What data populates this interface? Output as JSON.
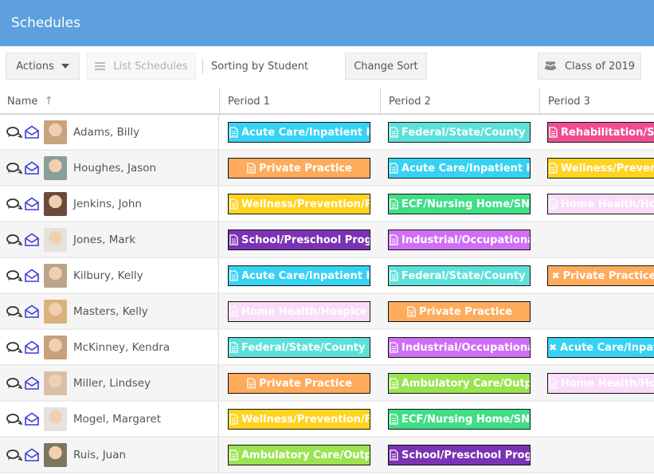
{
  "header": {
    "title": "Schedules"
  },
  "toolbar": {
    "actions_label": "Actions",
    "list_schedules_label": "List Schedules",
    "sorting_text": "Sorting by Student",
    "change_sort_label": "Change Sort",
    "class_label": "Class of 2019"
  },
  "columns": {
    "name": "Name",
    "p1": "Period 1",
    "p2": "Period 2",
    "p3": "Period 3"
  },
  "colors": {
    "acute": "#36d2f3",
    "federal": "#5ce1d9",
    "rehab": "#ef4d8f",
    "private": "#ffab5c",
    "wellness": "#ffd31f",
    "ecf": "#40df86",
    "home": "#fadcfa",
    "school": "#7b33b5",
    "industrial": "#d06ef5",
    "ambulatory": "#9be351",
    "header": "#5da0dd"
  },
  "rows": [
    {
      "name": "Adams, Billy",
      "p1": {
        "label": "Acute Care/Inpatient Hospital",
        "type": "acute",
        "icon": "file"
      },
      "p2": {
        "label": "Federal/State/County Health",
        "type": "federal",
        "icon": "file"
      },
      "p3": {
        "label": "Rehabilitation/Sub-Acute",
        "type": "rehab",
        "icon": "file"
      }
    },
    {
      "name": "Houghes, Jason",
      "p1": {
        "label": "Private Practice",
        "type": "private",
        "icon": "file"
      },
      "p2": {
        "label": "Acute Care/Inpatient Hospital",
        "type": "acute",
        "icon": "file"
      },
      "p3": {
        "label": "Wellness/Prevention/Fitness",
        "type": "wellness",
        "icon": "file"
      }
    },
    {
      "name": "Jenkins, John",
      "p1": {
        "label": "Wellness/Prevention/Fitness",
        "type": "wellness",
        "icon": "file"
      },
      "p2": {
        "label": "ECF/Nursing Home/SNF",
        "type": "ecf",
        "icon": "file"
      },
      "p3": {
        "label": "Home Health/Hospice",
        "type": "home",
        "icon": "file"
      }
    },
    {
      "name": "Jones, Mark",
      "p1": {
        "label": "School/Preschool Program",
        "type": "school",
        "icon": "file"
      },
      "p2": {
        "label": "Industrial/Occupational Health",
        "type": "industrial",
        "icon": "file"
      },
      "p3": null
    },
    {
      "name": "Kilbury, Kelly",
      "p1": {
        "label": "Acute Care/Inpatient Hospital",
        "type": "acute",
        "icon": "file"
      },
      "p2": {
        "label": "Federal/State/County Health",
        "type": "federal",
        "icon": "file"
      },
      "p3": {
        "label": "Private Practice",
        "type": "private",
        "icon": "x"
      }
    },
    {
      "name": "Masters, Kelly",
      "p1": {
        "label": "Home Health/Hospice",
        "type": "home",
        "icon": "file"
      },
      "p2": {
        "label": "Private Practice",
        "type": "private",
        "icon": "file"
      },
      "p3": null
    },
    {
      "name": "McKinney, Kendra",
      "p1": {
        "label": "Federal/State/County Health",
        "type": "federal",
        "icon": "file"
      },
      "p2": {
        "label": "Industrial/Occupational Health",
        "type": "industrial",
        "icon": "file"
      },
      "p3": {
        "label": "Acute Care/Inpatient Hospital",
        "type": "acute",
        "icon": "x"
      }
    },
    {
      "name": "Miller, Lindsey",
      "p1": {
        "label": "Private Practice",
        "type": "private",
        "icon": "file"
      },
      "p2": {
        "label": "Ambulatory Care/Outpatient",
        "type": "ambulatory",
        "icon": "file"
      },
      "p3": {
        "label": "Home Health/Hospice",
        "type": "home",
        "icon": "file"
      }
    },
    {
      "name": "Mogel, Margaret",
      "p1": {
        "label": "Wellness/Prevention/Fitness",
        "type": "wellness",
        "icon": "file"
      },
      "p2": {
        "label": "ECF/Nursing Home/SNF",
        "type": "ecf",
        "icon": "file"
      },
      "p3": null
    },
    {
      "name": "Ruis, Juan",
      "p1": {
        "label": "Ambulatory Care/Outpatient",
        "type": "ambulatory",
        "icon": "file"
      },
      "p2": {
        "label": "School/Preschool Program",
        "type": "school",
        "icon": "file"
      },
      "p3": null
    }
  ],
  "icons": {
    "chat": "chat-bubbles-icon",
    "mail": "envelope-open-icon",
    "sort": "arrow-up-icon",
    "group": "users-icon",
    "list": "list-icon",
    "file": "file-text-icon",
    "remove": "x-icon"
  }
}
